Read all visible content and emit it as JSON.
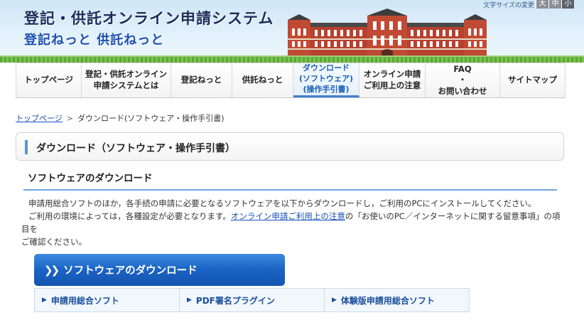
{
  "header": {
    "title_main": "登記・供託オンライン申請システム",
    "title_sub": "登記ねっと 供託ねっと",
    "font_size_label": "文字サイズの変更",
    "font_size_buttons": [
      "大",
      "中",
      "小"
    ]
  },
  "nav": {
    "items": [
      {
        "label": "トップページ"
      },
      {
        "label": "登記・供託オンライン\n申請システムとは"
      },
      {
        "label": "登記ねっと"
      },
      {
        "label": "供託ねっと"
      },
      {
        "label": "ダウンロード\n(ソフトウェア)\n(操作手引書)"
      },
      {
        "label": "オンライン申請\nご利用上の注意"
      },
      {
        "label": "FAQ\n・\nお問い合わせ"
      },
      {
        "label": "サイトマップ"
      }
    ]
  },
  "breadcrumb": {
    "home": "トップページ",
    "separator": ">",
    "current": "ダウンロード(ソフトウェア・操作手引書)"
  },
  "page_title": "ダウンロード（ソフトウェア・操作手引書）",
  "section": {
    "heading": "ソフトウェアのダウンロード",
    "line1": "申請用総合ソフトのほか，各手続の申請に必要となるソフトウェアを以下からダウンロードし，ご利用のPCにインストールしてください。",
    "line2_pre": "ご利用の環境によっては，各種設定が必要となります。",
    "line2_link": "オンライン申請ご利用上の注意",
    "line2_post": "の「お使いのPC／インターネットに関する留意事項」の項目を",
    "line3": "ご確認ください。"
  },
  "download": {
    "header_label": "ソフトウェアのダウンロード",
    "links": [
      {
        "label": "申請用総合ソフト"
      },
      {
        "label": "PDF署名プラグイン"
      },
      {
        "label": "体験版申請用総合ソフト"
      }
    ]
  },
  "colors": {
    "accent": "#1b63c4",
    "nav_active": "#1a5fb4",
    "link": "#1a4fb8"
  }
}
